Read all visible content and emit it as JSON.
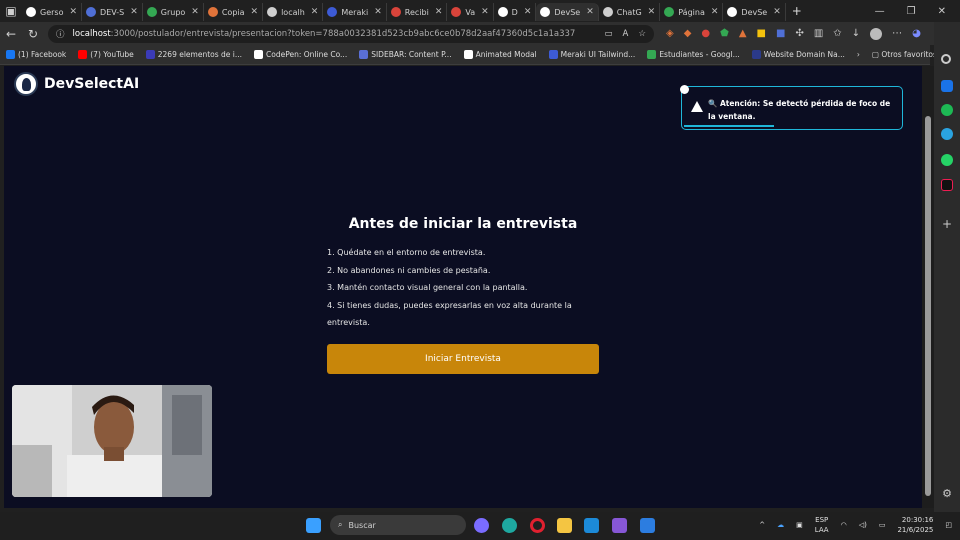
{
  "browser": {
    "tabs": [
      {
        "label": "Gerso",
        "color": "#ffffff"
      },
      {
        "label": "DEV-S",
        "color": "#4f6fd6"
      },
      {
        "label": "Grupo",
        "color": "#34a853"
      },
      {
        "label": "Copia",
        "color": "#e0733a"
      },
      {
        "label": "localh",
        "color": "#cfcfcf"
      },
      {
        "label": "Meraki",
        "color": "#3d5bd6"
      },
      {
        "label": "Recibi",
        "color": "#d9443b"
      },
      {
        "label": "Va",
        "color": "#d9443b"
      },
      {
        "label": "D",
        "color": "#ffffff"
      },
      {
        "label": "DevSe",
        "color": "#ffffff"
      },
      {
        "label": "ChatG",
        "color": "#cfcfcf"
      },
      {
        "label": "Página",
        "color": "#34a853"
      },
      {
        "label": "DevSe",
        "color": "#ffffff"
      }
    ],
    "url_host": "localhost",
    "url_rest": ":3000/postulador/entrevista/presentacion?token=788a0032381d523cb9abc6ce0b78d2aaf47360d5c1a1a337",
    "bookmarks": [
      {
        "label": "(1) Facebook",
        "color": "#1877f2"
      },
      {
        "label": "(7) YouTube",
        "color": "#ff0000"
      },
      {
        "label": "2269 elementos de i...",
        "color": "#3b3bb8"
      },
      {
        "label": "CodePen: Online Co...",
        "color": "#ffffff"
      },
      {
        "label": "SIDEBAR: Content P...",
        "color": "#5a6fd6"
      },
      {
        "label": "Animated Modal",
        "color": "#ffffff"
      },
      {
        "label": "Meraki UI Tailwind...",
        "color": "#3d5bd6"
      },
      {
        "label": "Estudiantes - Googl...",
        "color": "#34a853"
      },
      {
        "label": "Website Domain Na...",
        "color": "#2b3a8a"
      }
    ],
    "other_favorites": "Otros favoritos"
  },
  "app": {
    "name": "DevSelectAI",
    "toast_message": "🔍 Atención: Se detectó pérdida de foco de la ventana.",
    "title": "Antes de iniciar la entrevista",
    "rules": [
      "1. Quédate en el entorno de entrevista.",
      "2. No abandones ni cambies de pestaña.",
      "3. Mantén contacto visual general con la pantalla.",
      "4. Si tienes dudas, puedes expresarlas en voz alta durante la entrevista."
    ],
    "start_button": "Iniciar Entrevista",
    "accent": "#c8860a",
    "toast_border": "#1fb6d9"
  },
  "taskbar": {
    "search_placeholder": "Buscar",
    "lang_top": "ESP",
    "lang_bottom": "LAA",
    "time": "20:30:16",
    "date": "21/6/2025"
  }
}
